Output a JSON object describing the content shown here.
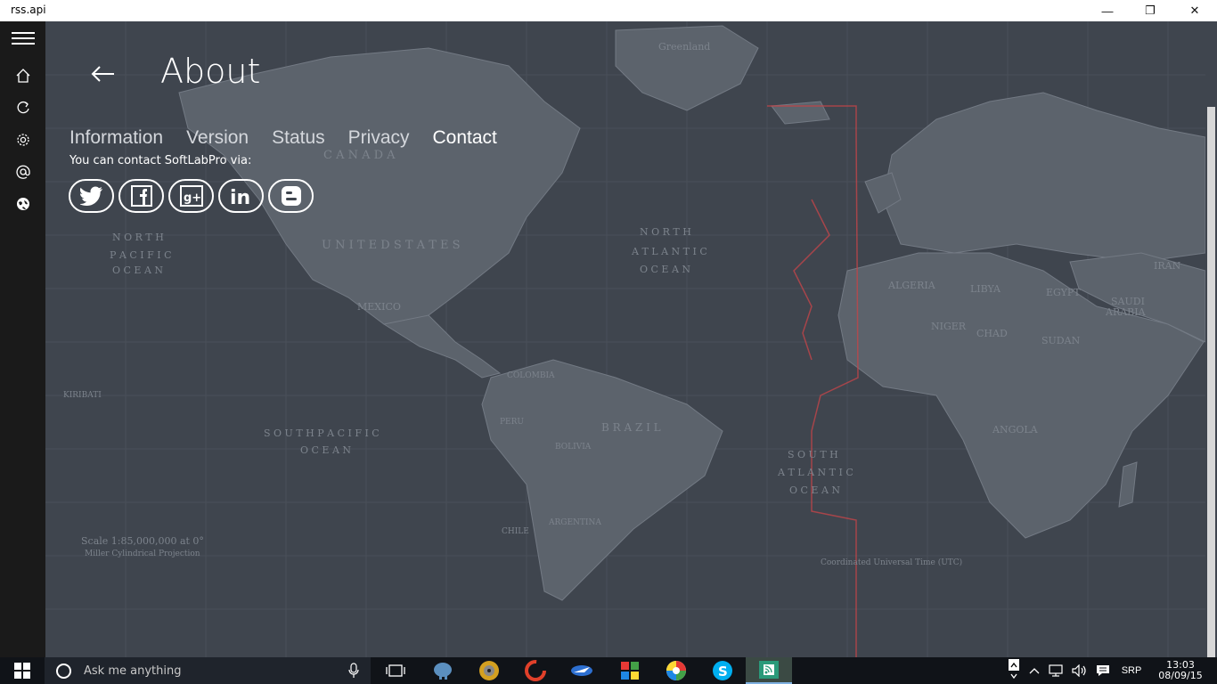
{
  "window": {
    "title": "rss.api",
    "minimize_glyph": "—",
    "restore_glyph": "❐",
    "close_glyph": "✕"
  },
  "nav": {
    "items": [
      {
        "icon": "hamburger-menu-icon"
      },
      {
        "icon": "home-icon"
      },
      {
        "icon": "refresh-icon"
      },
      {
        "icon": "settings-gear-icon"
      },
      {
        "icon": "at-sign-icon"
      },
      {
        "icon": "globe-icon"
      }
    ]
  },
  "page": {
    "title": "About",
    "tabs": [
      {
        "label": "Information"
      },
      {
        "label": "Version"
      },
      {
        "label": "Status"
      },
      {
        "label": "Privacy"
      },
      {
        "label": "Contact",
        "active": true
      }
    ],
    "contact_text": "You can contact SoftLabPro via:",
    "socials": [
      "twitter-icon",
      "facebook-icon",
      "google-plus-icon",
      "linkedin-icon",
      "blogger-icon"
    ]
  },
  "map_labels": {
    "greenland": "Greenland",
    "canada": "C A N A D A",
    "usa": "U N I T E D   S T A T E S",
    "north_pacific": "N O R T H",
    "pacific": "P A C I F I C",
    "ocean": "O C E A N",
    "north_atlantic": "N O R T H",
    "atlantic": "A T L A N T I C",
    "ocean2": "O C E A N",
    "mexico": "MEXICO",
    "brazil": "B R A Z I L",
    "south_pacific": "S O U T H   P A C I F I C",
    "ocean3": "O C E A N",
    "south_atlantic": "S O U T H",
    "atlantic2": "A T L A N T I C",
    "ocean4": "O C E A N",
    "algeria": "ALGERIA",
    "libya": "LIBYA",
    "egypt": "EGYPT",
    "sudan": "SUDAN",
    "niger": "NIGER",
    "chad": "CHAD",
    "angola": "ANGOLA",
    "iran": "IRAN",
    "saudi": "SAUDI",
    "arabia": "ARABIA",
    "peru": "PERU",
    "bolivia": "BOLIVIA",
    "chile": "CHILE",
    "argentina": "ARGENTINA",
    "colombia": "COLOMBIA",
    "kiribati": "KIRIBATI",
    "scale": "Scale 1:85,000,000 at 0°",
    "projection": "Miller Cylindrical Projection",
    "utc": "Coordinated Universal Time (UTC)"
  },
  "taskbar": {
    "search_placeholder": "Ask me anything",
    "tray_language": "SRP",
    "time": "13:03",
    "date": "08/09/15",
    "apps": [
      "task-view-icon",
      "elephant-app-icon",
      "disc-app-icon",
      "ccleaner-icon",
      "airplane-app-icon",
      "store-app-icon",
      "picasa-icon",
      "skype-icon",
      "rss-app-icon"
    ]
  },
  "colors": {
    "accent_red": "#c0454a",
    "background": "#3f454e",
    "land": "#5c636c",
    "nav": "#1a1a1a"
  }
}
